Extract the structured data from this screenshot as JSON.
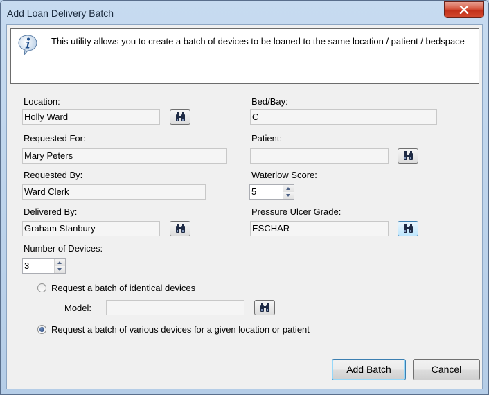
{
  "window": {
    "title": "Add Loan Delivery Batch"
  },
  "info": {
    "text": "This utility allows you to create a batch of devices to be loaned to the same location / patient / bedspace"
  },
  "form": {
    "location_label": "Location:",
    "location_value": "Holly Ward",
    "bed_label": "Bed/Bay:",
    "bed_value": "C",
    "requested_for_label": "Requested For:",
    "requested_for_value": "Mary Peters",
    "patient_label": "Patient:",
    "patient_value": "",
    "requested_by_label": "Requested By:",
    "requested_by_value": "Ward Clerk",
    "waterlow_label": "Waterlow Score:",
    "waterlow_value": "5",
    "delivered_by_label": "Delivered By:",
    "delivered_by_value": "Graham Stanbury",
    "ulcer_label": "Pressure Ulcer Grade:",
    "ulcer_value": "ESCHAR",
    "devices_label": "Number of Devices:",
    "devices_value": "3"
  },
  "batch": {
    "identical_label": "Request a batch of identical devices",
    "model_label": "Model:",
    "model_value": "",
    "various_label": "Request a batch of various devices for a given location or patient",
    "selected": "various"
  },
  "buttons": {
    "add_batch": "Add Batch",
    "cancel": "Cancel"
  },
  "icons": {
    "info": "info-icon",
    "find": "binoculars-icon",
    "close": "close-icon"
  }
}
